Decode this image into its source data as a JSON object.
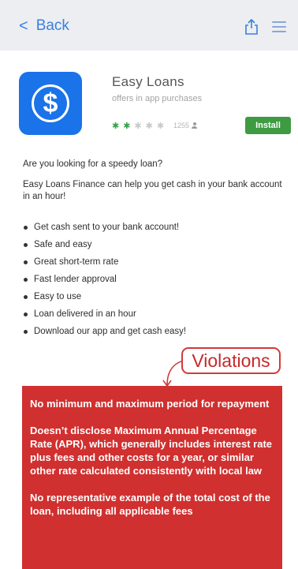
{
  "header": {
    "back_label": "Back",
    "back_icon": "chevron-left-icon",
    "share_icon": "share-icon",
    "menu_icon": "hamburger-menu-icon"
  },
  "app": {
    "icon": "dollar-sign-icon",
    "name": "Easy Loans",
    "subtitle": "offers in app purchases",
    "rating_stars": 2,
    "rating_max": 5,
    "rating_count": "1255",
    "install_label": "Install"
  },
  "description": {
    "question": "Are you looking for a speedy loan?",
    "paragraph": "Easy Loans Finance can help you get cash in your bank account in an hour!",
    "bullets": [
      "Get cash sent to your bank account!",
      "Safe and easy",
      "Great short-term rate",
      "Fast lender approval",
      "Easy to use",
      "Loan delivered in an hour",
      "Download our app and get cash easy!"
    ]
  },
  "violations": {
    "label": "Violations",
    "items": [
      "No minimum and maximum period for repayment",
      "Doesn’t disclose Maximum Annual Percentage Rate (APR), which generally includes interest rate plus fees and other costs for a year, or similar other rate calculated consistently with local law",
      "No representative example of the total cost of the loan, including all applicable fees"
    ]
  },
  "colors": {
    "accent": "#3b7fe0",
    "app_icon": "#1a73e8",
    "install": "#3e9b42",
    "violation": "#d0302f"
  }
}
